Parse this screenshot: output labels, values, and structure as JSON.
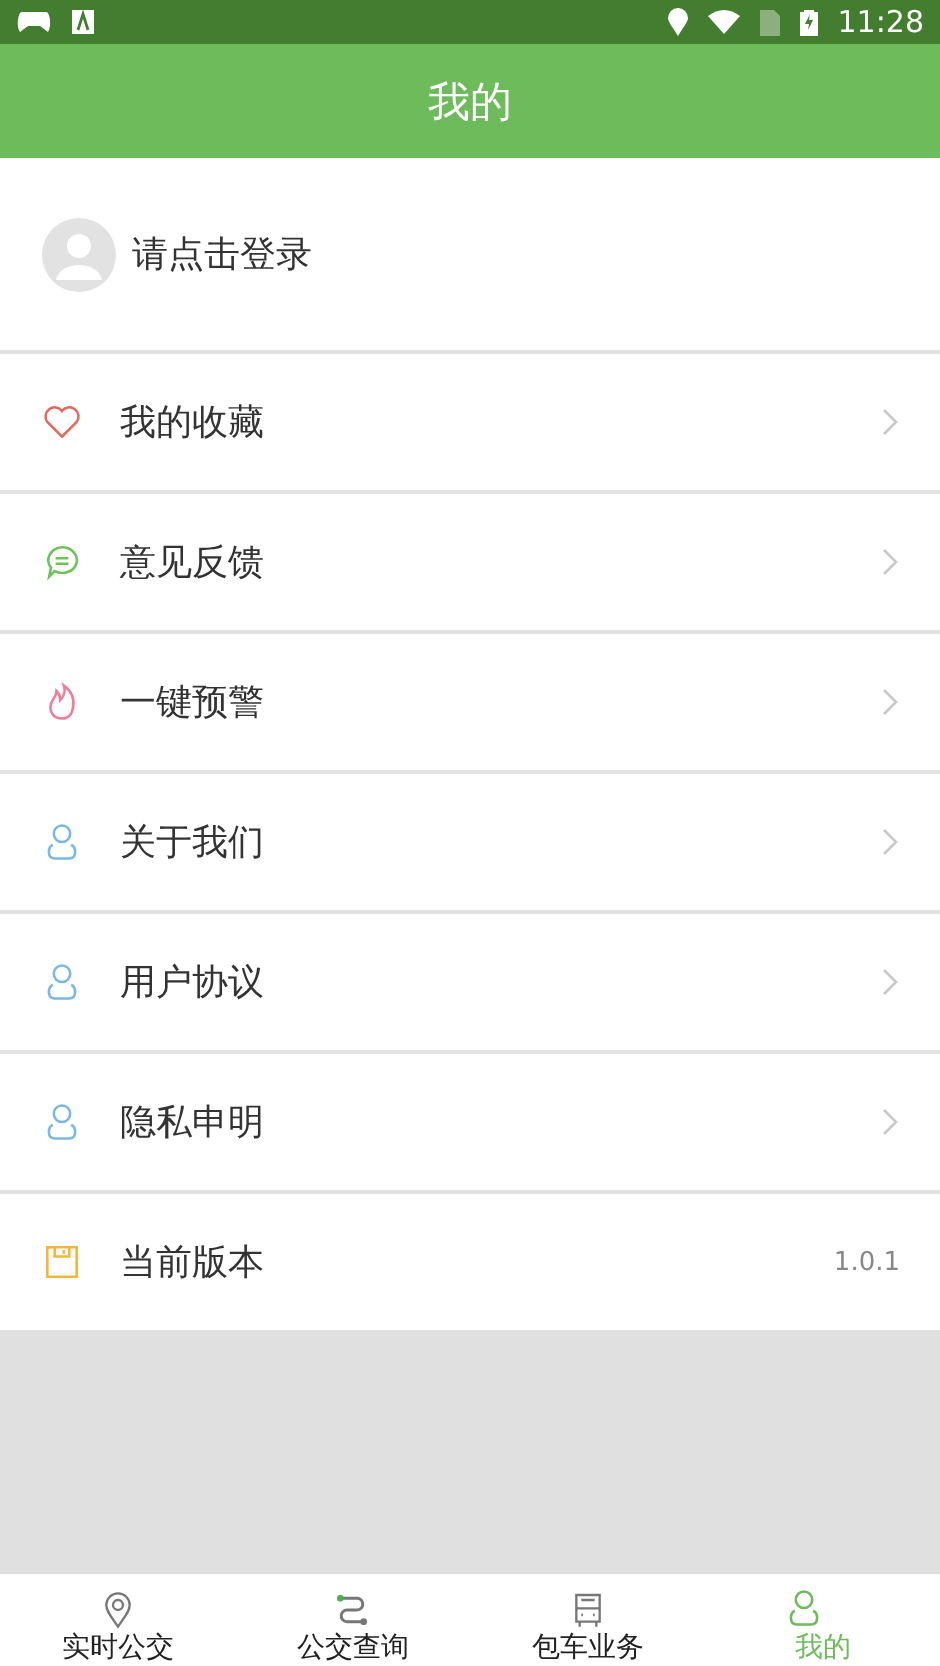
{
  "status_bar": {
    "time": "11:28"
  },
  "header": {
    "title": "我的"
  },
  "profile": {
    "label": "请点击登录"
  },
  "menu": [
    {
      "label": "我的收藏"
    },
    {
      "label": "意见反馈"
    },
    {
      "label": "一键预警"
    },
    {
      "label": "关于我们"
    },
    {
      "label": "用户协议"
    },
    {
      "label": "隐私申明"
    },
    {
      "label": "当前版本",
      "value": "1.0.1"
    }
  ],
  "tabs": [
    {
      "label": "实时公交",
      "selected": false
    },
    {
      "label": "公交查询",
      "selected": false
    },
    {
      "label": "包车业务",
      "selected": false
    },
    {
      "label": "我的",
      "selected": true
    }
  ]
}
